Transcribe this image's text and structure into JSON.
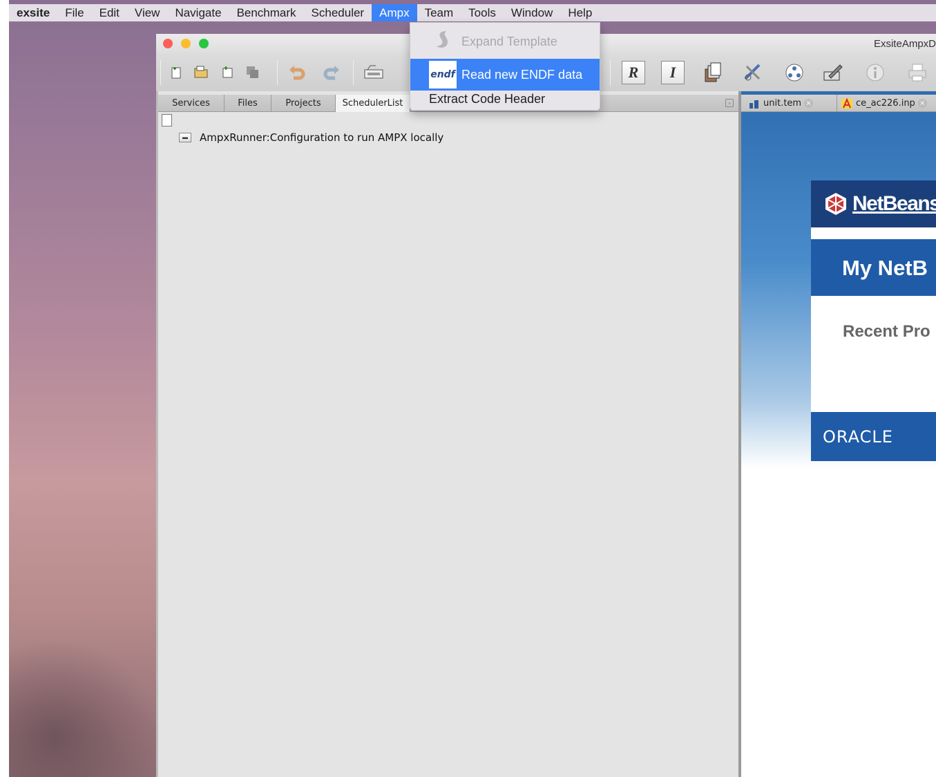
{
  "menubar": {
    "app_name": "exsite",
    "items": [
      "File",
      "Edit",
      "View",
      "Navigate",
      "Benchmark",
      "Scheduler",
      "Ampx",
      "Team",
      "Tools",
      "Window",
      "Help"
    ],
    "active_item": "Ampx"
  },
  "window": {
    "title": "ExsiteAmpxD"
  },
  "ampx_menu": {
    "items": [
      {
        "label": "Expand Template",
        "state": "disabled",
        "icon": "template-icon"
      },
      {
        "label": "Read new ENDF data",
        "state": "highlighted",
        "icon": "endf-icon",
        "icon_text": "endf"
      },
      {
        "label": "Extract Code Header",
        "state": "enabled",
        "icon": ""
      }
    ]
  },
  "left_panel": {
    "tabs": [
      "Services",
      "Files",
      "Projects",
      "SchedulerList"
    ],
    "selected_tab": "SchedulerList",
    "tree_items": [
      {
        "label": "AmpxRunner:Configuration to run AMPX locally",
        "icon": "runner-icon"
      }
    ]
  },
  "editor": {
    "tabs": [
      {
        "label": "unit.tem",
        "icon": "unit-template-icon"
      },
      {
        "label": "ce_ac226.inp",
        "icon": "input-file-icon"
      }
    ],
    "start_page": {
      "logo_text": "NetBeans",
      "heading": "My NetB",
      "section": "Recent Pro",
      "footer_brand": "ORACLE"
    }
  },
  "colors": {
    "menu_highlight": "#3b82f6",
    "netbeans_dark_blue": "#1b3f7a",
    "netbeans_blue": "#1f5ba7",
    "traffic_close": "#fc5f57",
    "traffic_min": "#fdbc2e",
    "traffic_max": "#27c840"
  },
  "toolbar_icons": [
    "new-file-icon",
    "open-project-icon",
    "new-project-icon",
    "save-all-icon",
    "undo-icon",
    "redo-icon",
    "ampx-runner-icon",
    "r-icon",
    "i-icon",
    "document-stack-icon",
    "tools-icon",
    "network-icon",
    "edit-icon",
    "info-icon",
    "print-icon"
  ]
}
